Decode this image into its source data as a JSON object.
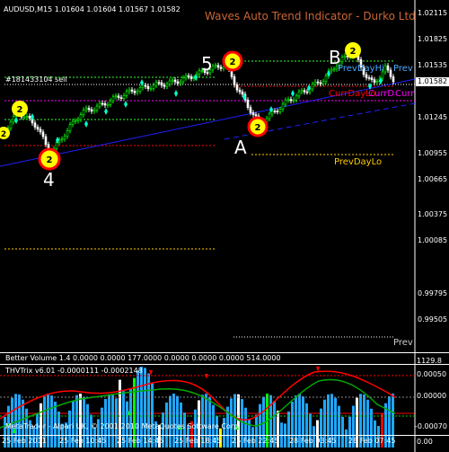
{
  "window": {
    "header_text": "AUDUSD,M15  1.01604 1.01604 1.01567 1.01582",
    "indicator_title": "Waves Auto Trend Indicator - Durko Ltd",
    "order_line_label": "#181433104 sell",
    "price_tag": "1.01582"
  },
  "price_axis": [
    "1.02115",
    "1.01825",
    "1.01535",
    "1.01245",
    "1.00955",
    "1.00665",
    "1.00375",
    "1.00085",
    "0.99795",
    "0.99505"
  ],
  "wave_labels": {
    "five": "5",
    "four": "4",
    "a": "A",
    "b": "B"
  },
  "wave_circle_label": "2",
  "level_labels": {
    "prev_day_hi": "PrevDayHi",
    "prev_day_hi_clip": "Prev",
    "curr_day_lo": "CurrDayLo",
    "curr_day_open": "CurrDayOpen",
    "curr_clip": "Curr",
    "prev_day_lo": "PrevDayLo",
    "prev_clip": "Prev"
  },
  "volume_panel": {
    "title": "Better Volume 1.4 0.0000 0.0000 177.0000 0.0000 0.0000 0.0000 514.0000",
    "axis_top": "1129.8",
    "axis_bottom": "0.00"
  },
  "thv_panel": {
    "title": "THVTrix v6.01 -0.0000111 -0.0002148",
    "axis": [
      "0.00050",
      "0.00000",
      "-0.00070"
    ]
  },
  "time_axis": [
    "25 Feb 2011",
    "25 Feb 10:45",
    "25 Feb 14:45",
    "25 Feb 18:45",
    "25 Feb 22:45",
    "28 Feb 03:45",
    "28 Feb 07:45"
  ],
  "footer": "MetaTrader - Alpari UK, © 2001-2010 MetaQuotes Software Corp.",
  "colors": {
    "bull_candle": "#00ff00",
    "bear_candle": "#ffffff",
    "prev_day_hi": "#4aa8ff",
    "curr_day_lo": "#ff0000",
    "curr_day_open": "#ff00ff",
    "prev_day_lo": "#ffcc00",
    "trend_line": "#2020ff",
    "title_orange": "#cc6633"
  }
}
